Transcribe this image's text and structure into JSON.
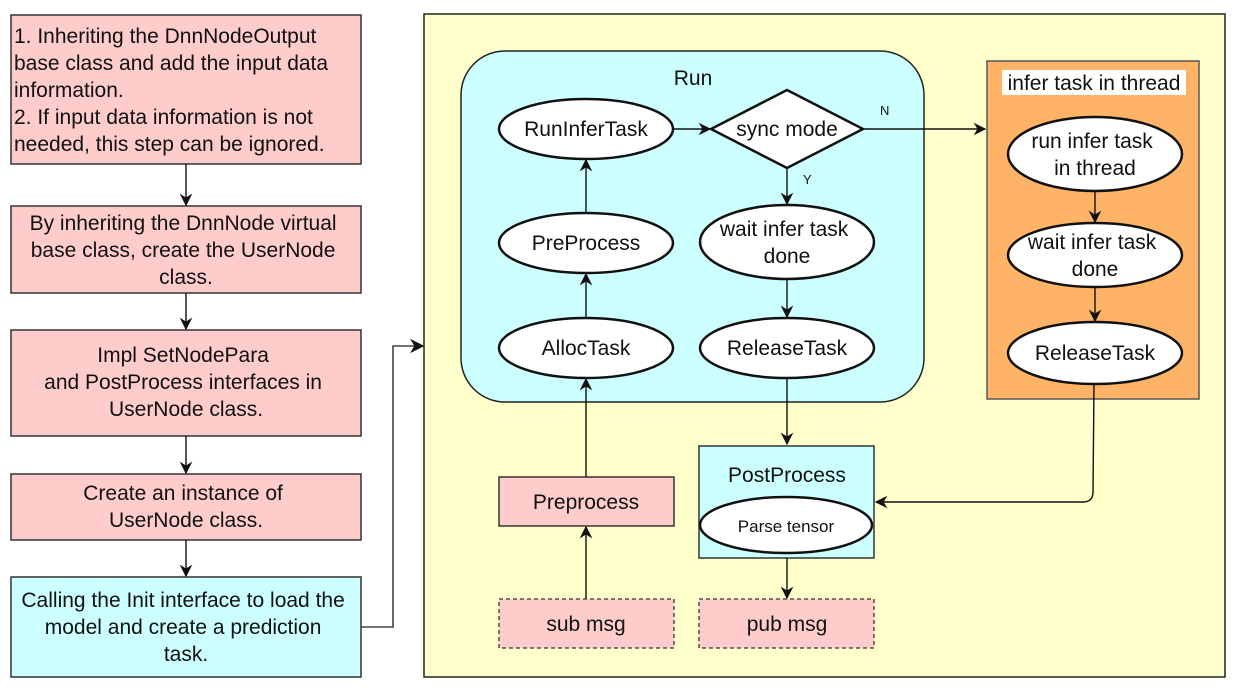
{
  "colors": {
    "pink": "#ffcccc",
    "cyan": "#ccffff",
    "yellow": "#ffffcc",
    "orange": "#ffb366",
    "white": "#ffffff",
    "stroke": "#111111"
  },
  "left_steps": [
    {
      "lines": [
        "1. Inheriting the DnnNodeOutput",
        "base class and add the input data",
        "information.",
        "2. If input data information is not",
        "needed, this step can be ignored."
      ]
    },
    {
      "lines": [
        "By inheriting the DnnNode virtual",
        "base class, create the UserNode",
        "class."
      ]
    },
    {
      "lines": [
        "Impl SetNodePara",
        "and PostProcess interfaces in",
        "UserNode class."
      ]
    },
    {
      "lines": [
        "Create an instance of",
        "UserNode class."
      ]
    },
    {
      "lines": [
        "Calling the Init interface to load the",
        "model and create a prediction",
        "task."
      ]
    }
  ],
  "run_group": {
    "title": "Run",
    "nodes": {
      "run_infer_task": "RunInferTask",
      "sync_mode": "sync mode",
      "preprocess": "PreProcess",
      "wait_done": [
        "wait infer task",
        "done"
      ],
      "alloc_task": "AllocTask",
      "release_task": "ReleaseTask"
    },
    "edge_labels": {
      "no": "N",
      "yes": "Y"
    }
  },
  "thread_group": {
    "title": "infer task in thread",
    "nodes": {
      "run_in_thread": [
        "run infer task",
        "in thread"
      ],
      "wait_done": [
        "wait infer task",
        "done"
      ],
      "release_task": "ReleaseTask"
    }
  },
  "bottom": {
    "preprocess": "Preprocess",
    "postprocess_title": "PostProcess",
    "parse_tensor": "Parse tensor",
    "sub_msg": "sub msg",
    "pub_msg": "pub msg"
  }
}
